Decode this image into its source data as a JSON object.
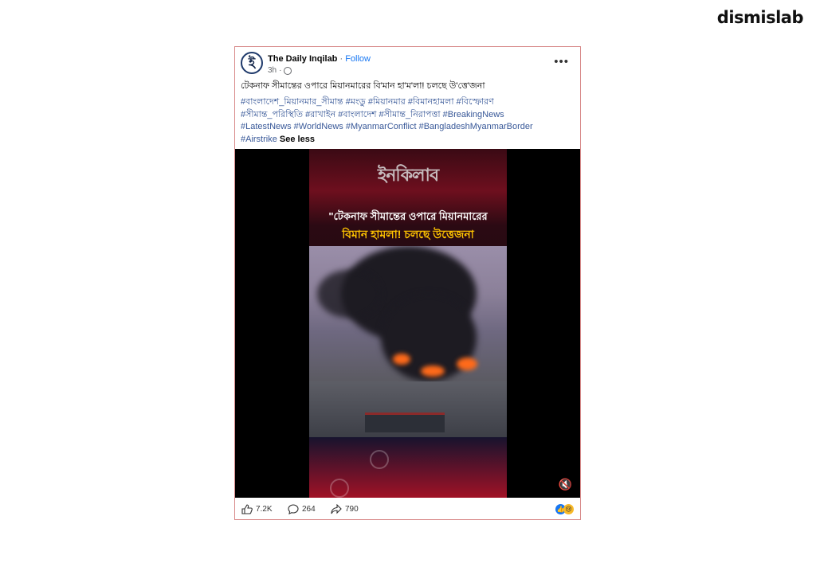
{
  "brand": "dismislab",
  "post": {
    "page_name": "The Daily Inqilab",
    "separator": "·",
    "follow_label": "Follow",
    "time": "3h",
    "avatar_letter": "ই",
    "more_label": "•••",
    "text": "টেকনাফ সীমান্তের ওপারে মিয়ানমারের বি'মান হা'ম'লা! চলছে উ'ত্তে'জনা",
    "hashtags": [
      "#বাংলাদেশ_মিয়ানমার_সীমান্ত",
      "#মংডু",
      "#মিয়ানমার",
      "#বিমানহামলা",
      "#বিস্ফোরণ",
      "#সীমান্ত_পরিস্থিতি",
      "#রাখাইন",
      "#বাংলাদেশ",
      "#সীমান্ত_নিরাপত্তা",
      "#BreakingNews",
      "#LatestNews",
      "#WorldNews",
      "#MyanmarConflict",
      "#BangladeshMyanmarBorder",
      "#Airstrike"
    ],
    "see_less": "See less"
  },
  "video": {
    "logo_text": "ইনকিলাব",
    "headline_line1": "\"টেকনাফ সীমান্তের ওপারে মিয়ানমারের",
    "headline_line2": "বিমান হামলা! চলছে উত্তেজনা",
    "mute_icon": "🔇"
  },
  "footer": {
    "likes": "7.2K",
    "comments": "264",
    "shares": "790",
    "reaction_icons": [
      "like-reaction",
      "sad-reaction"
    ]
  }
}
